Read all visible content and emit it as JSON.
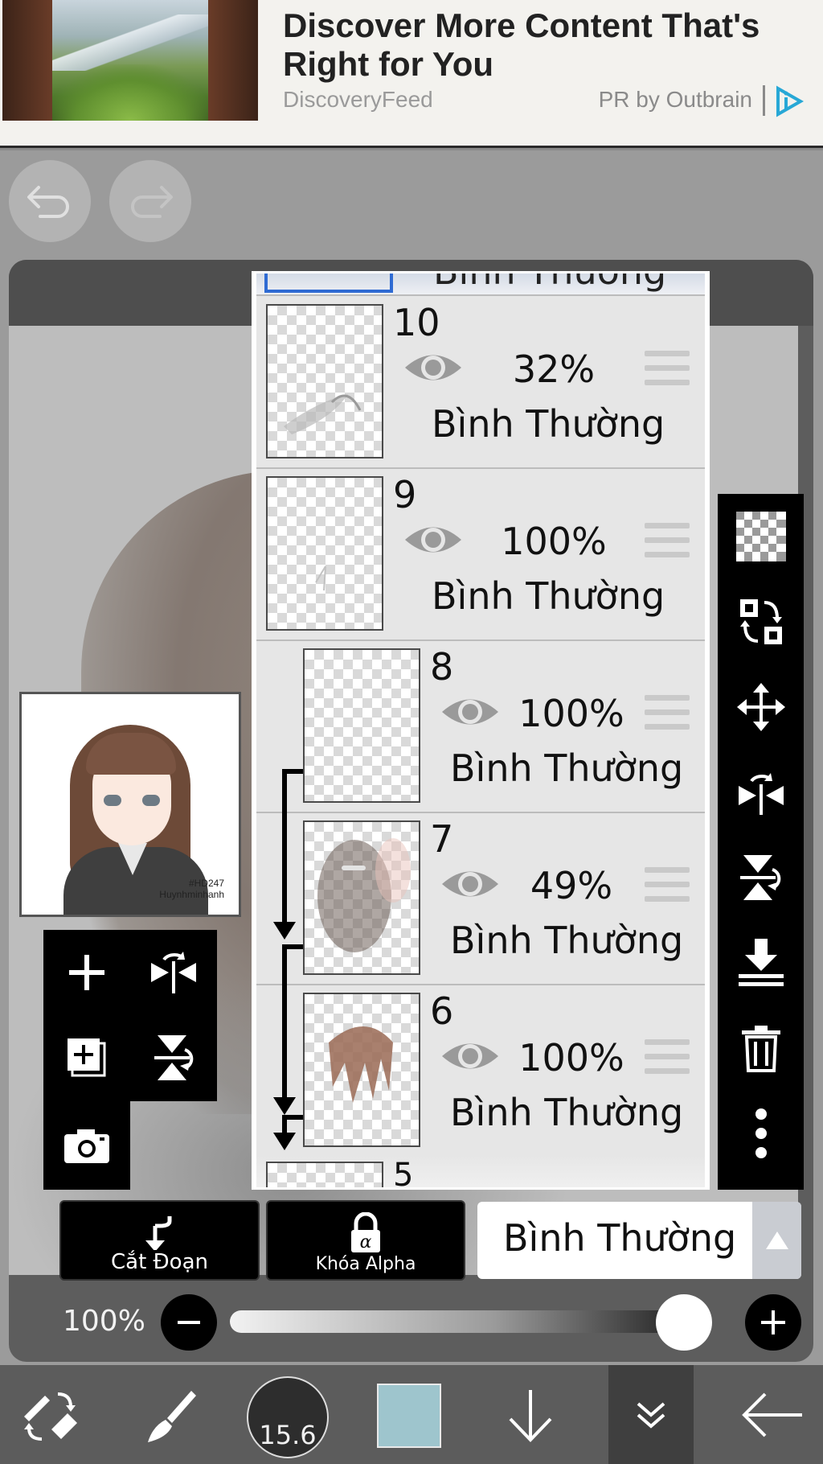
{
  "ad": {
    "title": "Discover More Content That's Right for You",
    "source": "DiscoveryFeed",
    "pr": "PR by Outbrain"
  },
  "preview": {
    "signature_line1": "#HD247",
    "signature_line2": "Huynhminhanh"
  },
  "layers": {
    "top_partial_mode": "Bình Thường",
    "items": [
      {
        "number": "10",
        "opacity": "32%",
        "mode": "Bình Thường",
        "clipped": false
      },
      {
        "number": "9",
        "opacity": "100%",
        "mode": "Bình Thường",
        "clipped": false
      },
      {
        "number": "8",
        "opacity": "100%",
        "mode": "Bình Thường",
        "clipped": true
      },
      {
        "number": "7",
        "opacity": "49%",
        "mode": "Bình Thường",
        "clipped": true
      },
      {
        "number": "6",
        "opacity": "100%",
        "mode": "Bình Thường",
        "clipped": true
      }
    ],
    "bottom_partial_number": "5"
  },
  "options": {
    "clip_label": "Cắt Đoạn",
    "alpha_lock_label": "Khóa Alpha",
    "blend_mode": "Bình Thường"
  },
  "opacity": {
    "label": "100%",
    "value": 1.0
  },
  "bottom_bar": {
    "brush_size": "15.6",
    "color": "#9ec5cd"
  },
  "icons": {
    "undo": "undo-icon",
    "redo": "redo-icon",
    "add_layer": "plus-icon",
    "flip_horizontal": "flip-horizontal-icon",
    "duplicate_layer": "add-layer-copy-icon",
    "flip_vertical": "flip-vertical-icon",
    "camera": "camera-icon",
    "transparency": "checker-icon",
    "move_layer": "swap-layer-icon",
    "move": "move-arrows-icon",
    "flip_h_panel": "flip-horizontal-icon",
    "flip_v_panel": "flip-vertical-icon",
    "merge_down": "merge-down-icon",
    "delete": "trash-icon",
    "more": "more-vertical-icon"
  }
}
